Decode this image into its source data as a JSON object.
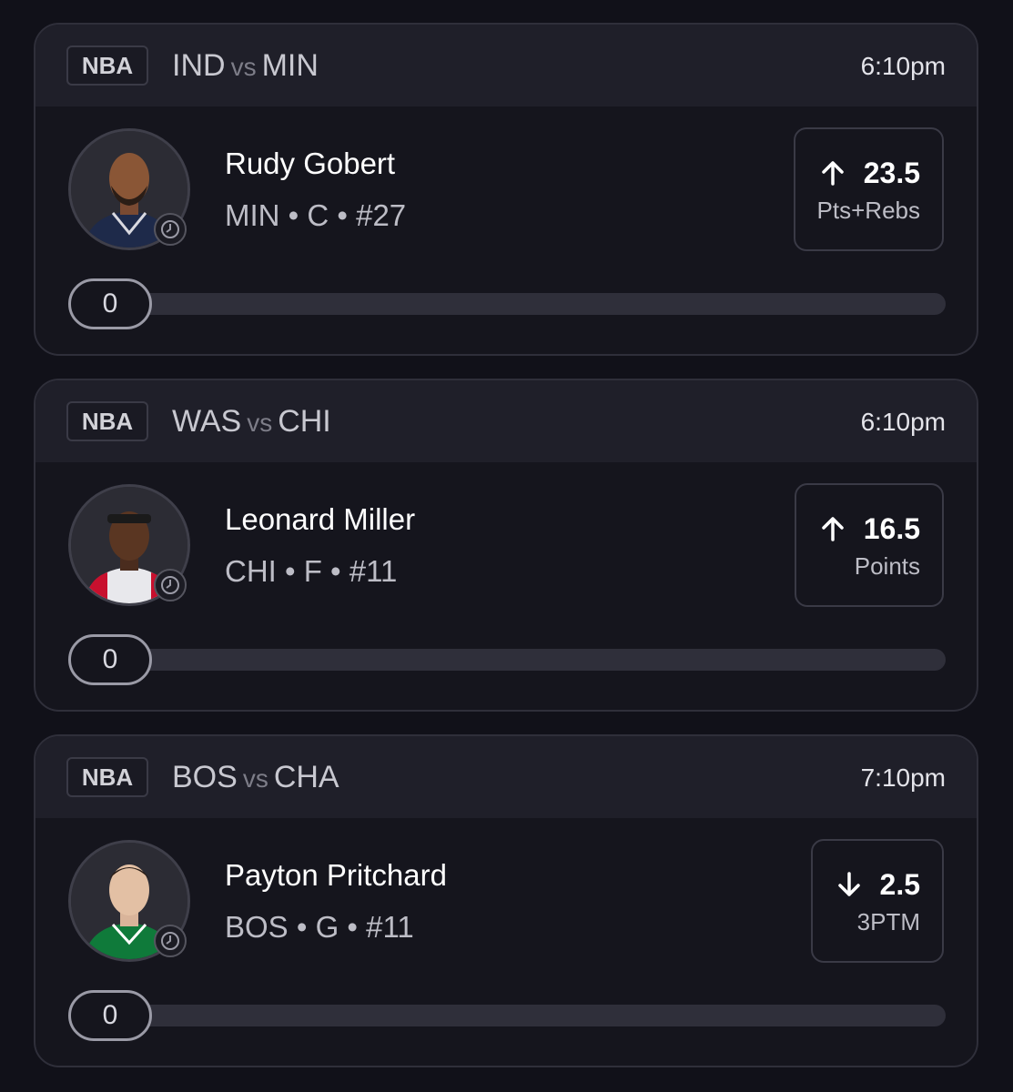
{
  "colors": {
    "background": "#111119",
    "card": "#15151d",
    "card_header": "#1f1f29",
    "border": "#2f2f3a",
    "text_primary": "#ffffff",
    "text_secondary": "#bdbdc6"
  },
  "cards": [
    {
      "league": "NBA",
      "team_a": "IND",
      "vs": "vs",
      "team_b": "MIN",
      "time": "6:10pm",
      "player_name": "Rudy Gobert",
      "player_meta": "MIN • C • #27",
      "direction_icon": "arrow-up-icon",
      "line_value": "23.5",
      "stat_type": "Pts+Rebs",
      "current_value": "0",
      "progress_fraction": 0
    },
    {
      "league": "NBA",
      "team_a": "WAS",
      "vs": "vs",
      "team_b": "CHI",
      "time": "6:10pm",
      "player_name": "Leonard Miller",
      "player_meta": "CHI • F • #11",
      "direction_icon": "arrow-up-icon",
      "line_value": "16.5",
      "stat_type": "Points",
      "current_value": "0",
      "progress_fraction": 0
    },
    {
      "league": "NBA",
      "team_a": "BOS",
      "vs": "vs",
      "team_b": "CHA",
      "time": "7:10pm",
      "player_name": "Payton Pritchard",
      "player_meta": "BOS • G • #11",
      "direction_icon": "arrow-down-icon",
      "line_value": "2.5",
      "stat_type": "3PTM",
      "current_value": "0",
      "progress_fraction": 0
    }
  ]
}
